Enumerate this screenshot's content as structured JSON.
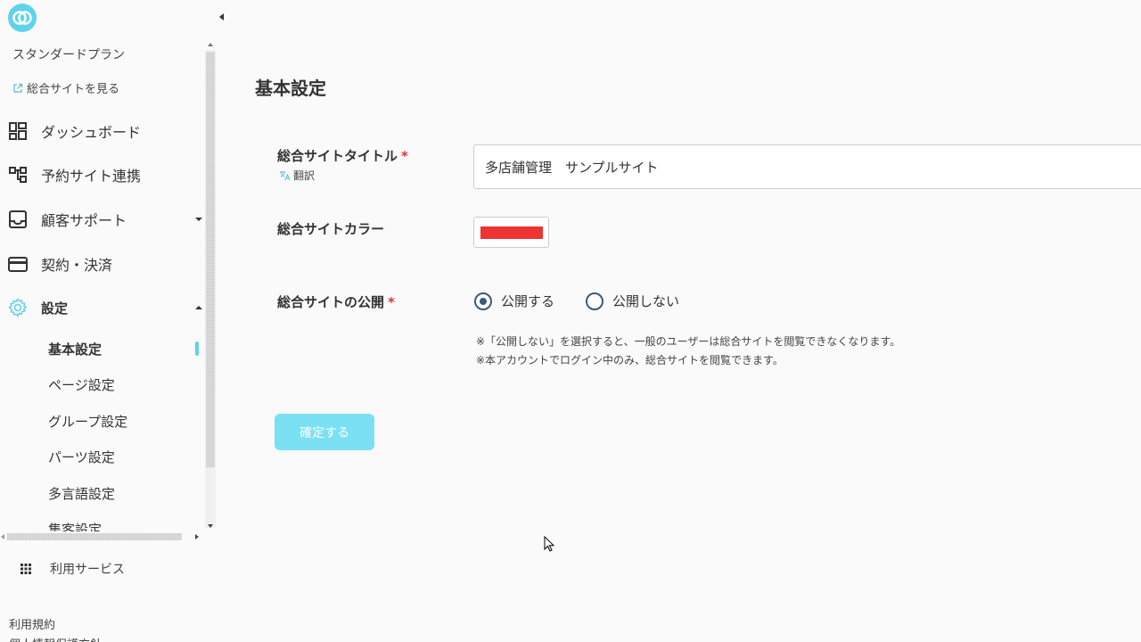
{
  "sidebar": {
    "plan": "スタンダードプラン",
    "site_link": "総合サイトを見る",
    "nav": [
      {
        "label": "ダッシュボード",
        "icon": "dashboard-icon"
      },
      {
        "label": "予約サイト連携",
        "icon": "hierarchy-icon"
      },
      {
        "label": "顧客サポート",
        "icon": "inbox-icon"
      },
      {
        "label": "契約・決済",
        "icon": "credit-card-icon"
      },
      {
        "label": "設定",
        "icon": "gear-icon"
      }
    ],
    "sub_items": [
      {
        "label": "基本設定",
        "active": true
      },
      {
        "label": "ページ設定"
      },
      {
        "label": "グループ設定"
      },
      {
        "label": "パーツ設定"
      },
      {
        "label": "多言語設定"
      },
      {
        "label": "集客設定"
      }
    ],
    "services": "利用サービス",
    "terms": "利用規約",
    "privacy": "個人情報保護方針"
  },
  "main": {
    "title": "基本設定",
    "fields": {
      "site_title_label": "総合サイトタイトル",
      "required_mark": "*",
      "translate": "翻訳",
      "site_title_value": "多店舗管理　サンプルサイト",
      "site_color_label": "総合サイトカラー",
      "site_color_value": "#ee3333",
      "publish_label": "総合サイトの公開",
      "publish_options": [
        "公開する",
        "公開しない"
      ],
      "publish_selected": "公開する"
    },
    "notes": [
      "※「公開しない」を選択すると、一般のユーザーは総合サイトを閲覧できなくなります。",
      "※本アカウントでログイン中のみ、総合サイトを閲覧できます。"
    ],
    "submit": "確定する"
  },
  "colors": {
    "accent": "#5fd3ec",
    "radio": "#3c5a7a",
    "submit_bg": "#7be0f3"
  }
}
